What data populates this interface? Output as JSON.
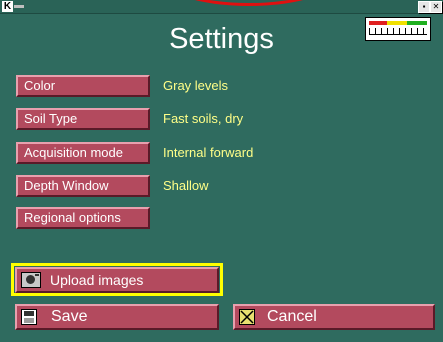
{
  "window": {
    "logo": "K",
    "minimize_glyph": "▪",
    "close_glyph": "✕"
  },
  "page": {
    "title": "Settings"
  },
  "settings": [
    {
      "label": "Color",
      "value": "Gray levels"
    },
    {
      "label": "Soil Type",
      "value": "Fast soils, dry"
    },
    {
      "label": "Acquisition mode",
      "value": "Internal forward"
    },
    {
      "label": "Depth Window",
      "value": "Shallow"
    },
    {
      "label": "Regional options"
    }
  ],
  "actions": {
    "upload_label": "Upload images",
    "save_label": "Save",
    "cancel_label": "Cancel"
  },
  "icons": {
    "upload": "camera-icon",
    "save": "floppy-disk-icon",
    "cancel": "cancel-x-icon"
  },
  "colors": {
    "background": "#2f6b5f",
    "button": "#b34a5e",
    "value_text": "#ffff88",
    "highlight": "#ffff00",
    "annotation": "#e01010"
  }
}
